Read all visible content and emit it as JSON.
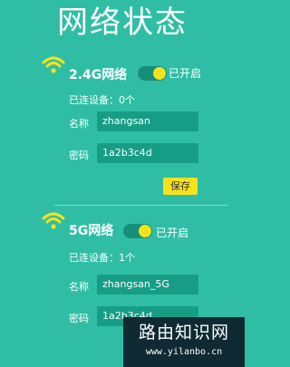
{
  "page": {
    "title": "网络状态"
  },
  "wifi_24": {
    "icon": "wifi-icon",
    "name": "2.4G网络",
    "toggle_label": "已开启",
    "devices": "已连设备：0个",
    "name_label": "名称",
    "name_value": "zhangsan",
    "password_label": "密码",
    "password_value": "1a2b3c4d",
    "save_label": "保存"
  },
  "wifi_5": {
    "icon": "wifi-icon",
    "name": "5G网络",
    "toggle_label": "已开启",
    "devices": "已连设备：1个",
    "name_label": "名称",
    "name_value": "zhangsan_5G",
    "password_label": "密码",
    "password_value": "1a2b3c4d"
  },
  "watermark": {
    "title": "路由知识网",
    "url": "www.yilanbo.cn"
  },
  "colors": {
    "background": "#2fbea5",
    "accent": "#f5e31a",
    "field": "#179d86"
  }
}
